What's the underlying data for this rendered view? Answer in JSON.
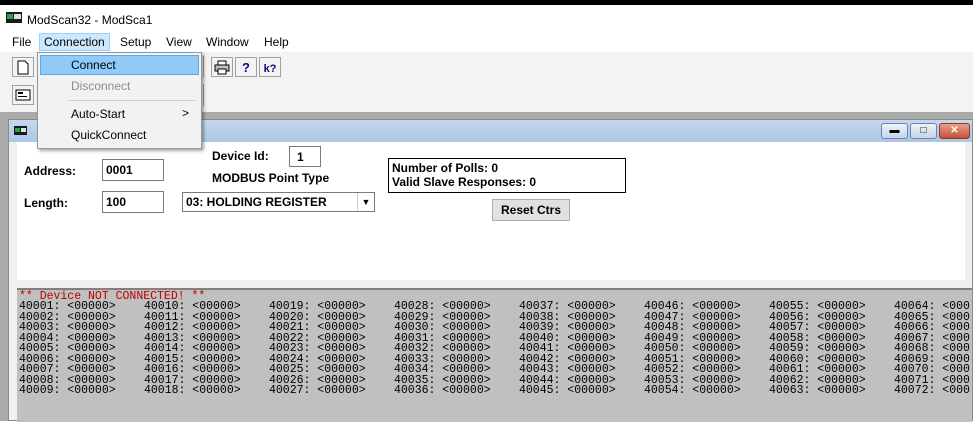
{
  "app": {
    "title": "ModScan32 - ModSca1"
  },
  "menubar": {
    "items": [
      {
        "label": "File"
      },
      {
        "label": "Connection"
      },
      {
        "label": "Setup"
      },
      {
        "label": "View"
      },
      {
        "label": "Window"
      },
      {
        "label": "Help"
      }
    ]
  },
  "connection_menu": {
    "items": [
      {
        "label": "Connect",
        "state": "highlighted"
      },
      {
        "label": "Disconnect",
        "state": "disabled"
      },
      {
        "label": "Auto-Start",
        "submenu_arrow": ">"
      },
      {
        "label": "QuickConnect"
      }
    ]
  },
  "toolbar": {
    "buttons": [
      "new-document-icon",
      "print-icon",
      "help-icon",
      "context-help-icon",
      "display-icon"
    ],
    "help_glyph": "?",
    "context_help_glyph": "k?"
  },
  "child_window": {
    "buttons": [
      "minimize-icon",
      "restore-icon",
      "close-icon"
    ]
  },
  "form": {
    "address_label": "Address:",
    "address_value": "0001",
    "length_label": "Length:",
    "length_value": "100",
    "device_id_label": "Device Id:",
    "device_id_value": "1",
    "point_type_label": "MODBUS Point Type",
    "point_type_value": "03: HOLDING REGISTER",
    "polls_text": "Number of Polls: 0",
    "responses_text": "Valid Slave Responses: 0",
    "reset_label": "Reset Ctrs"
  },
  "data": {
    "status": "** Device NOT CONNECTED! **",
    "rows": [
      [
        "40001: <00000>",
        "40010: <00000>",
        "40019: <00000>",
        "40028: <00000>",
        "40037: <00000>",
        "40046: <00000>",
        "40055: <00000>",
        "40064: <000"
      ],
      [
        "40002: <00000>",
        "40011: <00000>",
        "40020: <00000>",
        "40029: <00000>",
        "40038: <00000>",
        "40047: <00000>",
        "40056: <00000>",
        "40065: <000"
      ],
      [
        "40003: <00000>",
        "40012: <00000>",
        "40021: <00000>",
        "40030: <00000>",
        "40039: <00000>",
        "40048: <00000>",
        "40057: <00000>",
        "40066: <000"
      ],
      [
        "40004: <00000>",
        "40013: <00000>",
        "40022: <00000>",
        "40031: <00000>",
        "40040: <00000>",
        "40049: <00000>",
        "40058: <00000>",
        "40067: <000"
      ],
      [
        "40005: <00000>",
        "40014: <00000>",
        "40023: <00000>",
        "40032: <00000>",
        "40041: <00000>",
        "40050: <00000>",
        "40059: <00000>",
        "40068: <000"
      ],
      [
        "40006: <00000>",
        "40015: <00000>",
        "40024: <00000>",
        "40033: <00000>",
        "40042: <00000>",
        "40051: <00000>",
        "40060: <00000>",
        "40069: <000"
      ],
      [
        "40007: <00000>",
        "40016: <00000>",
        "40025: <00000>",
        "40034: <00000>",
        "40043: <00000>",
        "40052: <00000>",
        "40061: <00000>",
        "40070: <000"
      ],
      [
        "40008: <00000>",
        "40017: <00000>",
        "40026: <00000>",
        "40035: <00000>",
        "40044: <00000>",
        "40053: <00000>",
        "40062: <00000>",
        "40071: <000"
      ],
      [
        "40009: <00000>",
        "40018: <00000>",
        "40027: <00000>",
        "40036: <00000>",
        "40045: <00000>",
        "40054: <00000>",
        "40063: <00000>",
        "40072: <000"
      ]
    ]
  },
  "colors": {
    "menu_highlight": "#91c9f7",
    "status_text": "#c00000",
    "data_background": "#c0c0c0",
    "child_titlebar": "#adc6e5"
  }
}
